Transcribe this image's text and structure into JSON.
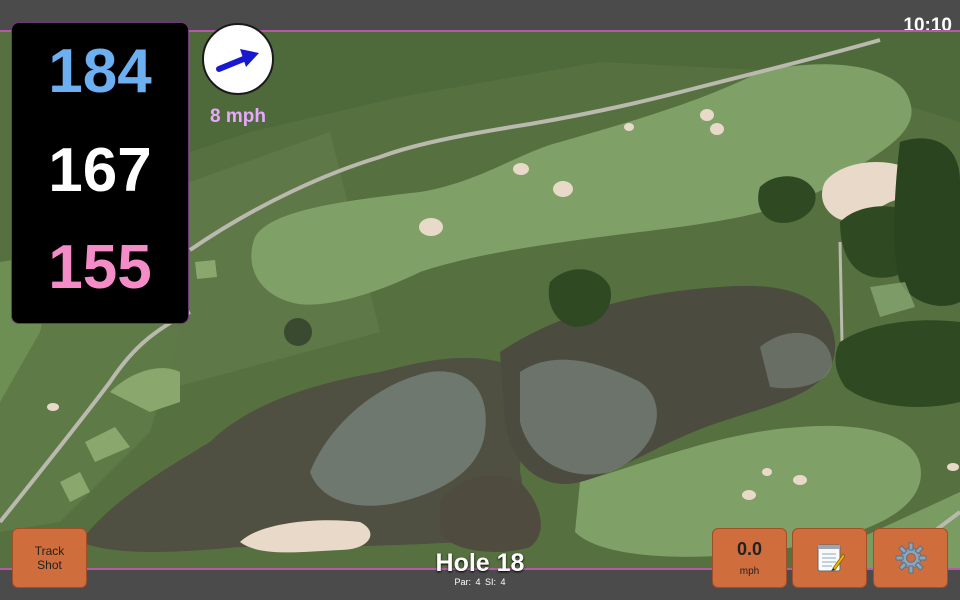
{
  "status_bar": {
    "time": "10:10"
  },
  "distances": {
    "back": "184",
    "middle": "167",
    "front": "155"
  },
  "wind": {
    "speed_label": "8 mph",
    "icon": "wind-direction-arrow-icon"
  },
  "hole": {
    "title": "Hole 18",
    "par_label": "Par: 4",
    "si_label": "SI: 4"
  },
  "buttons": {
    "track_shot_label": "Track\nShot",
    "speed_value": "0.0",
    "speed_unit": "mph",
    "notes_icon": "notepad-icon",
    "settings_icon": "gear-icon"
  },
  "colors": {
    "back_distance": "#6cb0f2",
    "middle_distance": "#ffffff",
    "front_distance": "#f48cc8",
    "button_bg": "#cf6d3d",
    "map_border": "#b45aa8"
  }
}
